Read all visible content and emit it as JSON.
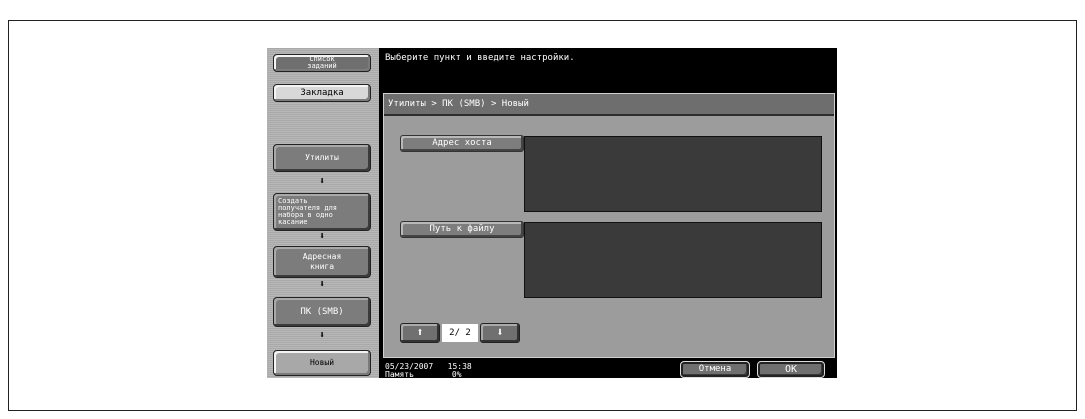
{
  "sidebar": {
    "job_list_label": "Список\nзаданий",
    "bookmark_label": "Закладка",
    "nav": [
      {
        "label": "Утилиты"
      },
      {
        "label": "Создать\nполучателя для\nнабора в одно\nкасание"
      },
      {
        "label": "Адресная\nкнига"
      },
      {
        "label": "ПК (SMB)"
      },
      {
        "label": "Новый"
      }
    ],
    "arrow_glyph": "⬇"
  },
  "header": {
    "message": "Выберите пункт и введите настройки."
  },
  "panel": {
    "breadcrumb": "Утилиты > ПК (SMB) > Новый",
    "fields": [
      {
        "label": "Адрес хоста",
        "value": ""
      },
      {
        "label": "Путь к файлу",
        "value": ""
      }
    ],
    "pager": {
      "up_glyph": "⬆",
      "down_glyph": "⬇",
      "page_text": "2/ 2"
    }
  },
  "status": {
    "date": "05/23/2007",
    "time": "15:38",
    "memory_label": "Память",
    "memory_value": "0%"
  },
  "buttons": {
    "cancel": "Отмена",
    "ok": "OK"
  },
  "colors": {
    "screen_bg": "#000000",
    "panel_bg": "#9c9c9c",
    "field_box_bg": "#3a3a3a"
  }
}
